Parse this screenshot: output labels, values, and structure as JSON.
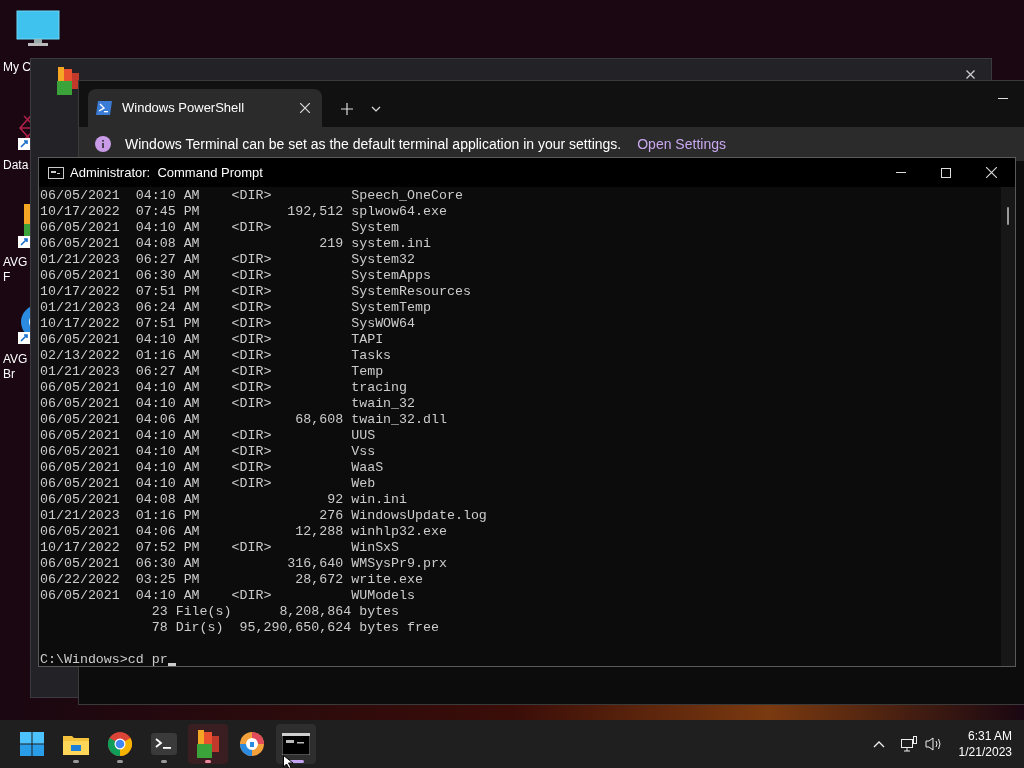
{
  "desktop_icons": [
    {
      "kind": "monitor",
      "label_lines": [
        "My C"
      ]
    },
    {
      "kind": "network",
      "label_lines": [
        "Data"
      ]
    },
    {
      "kind": "avg",
      "label_lines": [
        "AVG",
        "F"
      ]
    },
    {
      "kind": "browser",
      "label_lines": [
        "AVG",
        "Br"
      ]
    }
  ],
  "terminal_window": {
    "tabs": [
      {
        "title": "Windows PowerShell",
        "selected": true
      }
    ],
    "infobar": {
      "message": "Windows Terminal can be set as the default terminal application in your settings.",
      "link": "Open Settings"
    }
  },
  "cmd_window": {
    "title": "Administrator:  Command Prompt",
    "lines": [
      "06/05/2021  04:10 AM    <DIR>          Speech_OneCore",
      "10/17/2022  07:45 PM           192,512 splwow64.exe",
      "06/05/2021  04:10 AM    <DIR>          System",
      "06/05/2021  04:08 AM               219 system.ini",
      "01/21/2023  06:27 AM    <DIR>          System32",
      "06/05/2021  06:30 AM    <DIR>          SystemApps",
      "10/17/2022  07:51 PM    <DIR>          SystemResources",
      "01/21/2023  06:24 AM    <DIR>          SystemTemp",
      "10/17/2022  07:51 PM    <DIR>          SysWOW64",
      "06/05/2021  04:10 AM    <DIR>          TAPI",
      "02/13/2022  01:16 AM    <DIR>          Tasks",
      "01/21/2023  06:27 AM    <DIR>          Temp",
      "06/05/2021  04:10 AM    <DIR>          tracing",
      "06/05/2021  04:10 AM    <DIR>          twain_32",
      "06/05/2021  04:06 AM            68,608 twain_32.dll",
      "06/05/2021  04:10 AM    <DIR>          UUS",
      "06/05/2021  04:10 AM    <DIR>          Vss",
      "06/05/2021  04:10 AM    <DIR>          WaaS",
      "06/05/2021  04:10 AM    <DIR>          Web",
      "06/05/2021  04:08 AM                92 win.ini",
      "01/21/2023  01:16 PM               276 WindowsUpdate.log",
      "06/05/2021  04:06 AM            12,288 winhlp32.exe",
      "10/17/2022  07:52 PM    <DIR>          WinSxS",
      "06/05/2021  06:30 AM           316,640 WMSysPr9.prx",
      "06/22/2022  03:25 PM            28,672 write.exe",
      "06/05/2021  04:10 AM    <DIR>          WUModels",
      "              23 File(s)      8,208,864 bytes",
      "              78 Dir(s)  95,290,650,624 bytes free"
    ],
    "prompt": "C:\\Windows>cd pr"
  },
  "taskbar": {
    "apps": [
      {
        "kind": "start",
        "running": false,
        "selected": false,
        "flashing": false
      },
      {
        "kind": "explorer",
        "running": true,
        "selected": false,
        "flashing": false
      },
      {
        "kind": "chrome",
        "running": true,
        "selected": false,
        "flashing": false
      },
      {
        "kind": "terminal",
        "running": true,
        "selected": false,
        "flashing": false
      },
      {
        "kind": "avg",
        "running": true,
        "selected": false,
        "flashing": true
      },
      {
        "kind": "avg_browser",
        "running": false,
        "selected": false,
        "flashing": false
      },
      {
        "kind": "cmd",
        "running": true,
        "selected": true,
        "flashing": false
      }
    ],
    "time": "6:31 AM",
    "date": "1/21/2023"
  }
}
